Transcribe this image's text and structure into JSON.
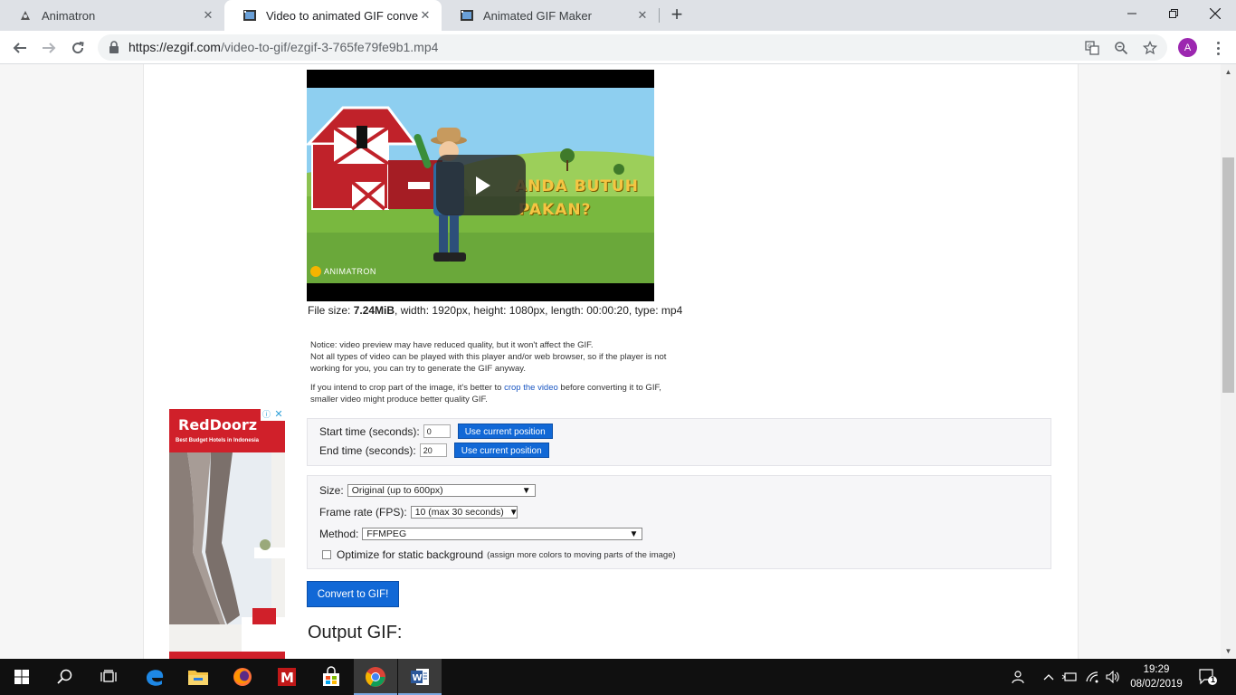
{
  "browser": {
    "tabs": [
      {
        "title": "Animatron"
      },
      {
        "title": "Video to animated GIF converter"
      },
      {
        "title": "Animated GIF Maker"
      }
    ],
    "url_host": "https://ezgif.com",
    "url_path": "/video-to-gif/ezgif-3-765fe79fe9b1.mp4",
    "profile_initial": "A"
  },
  "video": {
    "overlay_line1": "ANDA BUTUH",
    "overlay_line2": "PAKAN?",
    "watermark": "ANIMATRON"
  },
  "file_info": {
    "label": "File size:",
    "size": "7.24MiB",
    "rest": ", width: 1920px, height: 1080px, length: 00:00:20, type: mp4"
  },
  "notice": {
    "line1": "Notice: video preview may have reduced quality, but it won't affect the GIF.",
    "line2": "Not all types of video can be played with this player and/or web browser, so if the player is not working for you, you can try to generate the GIF anyway.",
    "crop_before": "If you intend to crop part of the image, it's better to ",
    "crop_link": "crop the video",
    "crop_after": " before converting it to GIF, smaller video might produce better quality GIF."
  },
  "time_form": {
    "start_label": "Start time (seconds):",
    "start_value": "0",
    "end_label": "End time (seconds):",
    "end_value": "20",
    "use_current_label": "Use current position"
  },
  "options": {
    "size_label": "Size:",
    "size_value": "Original (up to 600px)",
    "fps_label": "Frame rate (FPS):",
    "fps_value": "10 (max 30 seconds)",
    "method_label": "Method:",
    "method_value": "FFMPEG",
    "optimize_label": "Optimize for static background",
    "optimize_hint": "(assign more colors to moving parts of the image)",
    "optimize_checked": false
  },
  "convert_label": "Convert to GIF!",
  "output_title": "Output GIF:",
  "ad": {
    "brand": "RedDoorz",
    "tagline": "Best Budget Hotels in Indonesia",
    "info_glyph": "ⓘ",
    "close_glyph": "✕"
  },
  "taskbar": {
    "time": "19:29",
    "date": "08/02/2019",
    "notification_count": "1",
    "apps": [
      "windows-start",
      "search",
      "task-view",
      "edge",
      "file-explorer",
      "firefox",
      "mcafee",
      "store",
      "chrome",
      "word"
    ]
  },
  "colors": {
    "accent_blue": "#1168d6",
    "link_blue": "#1a56c2",
    "ad_red": "#d0202a",
    "profile_purple": "#9c27b0"
  }
}
